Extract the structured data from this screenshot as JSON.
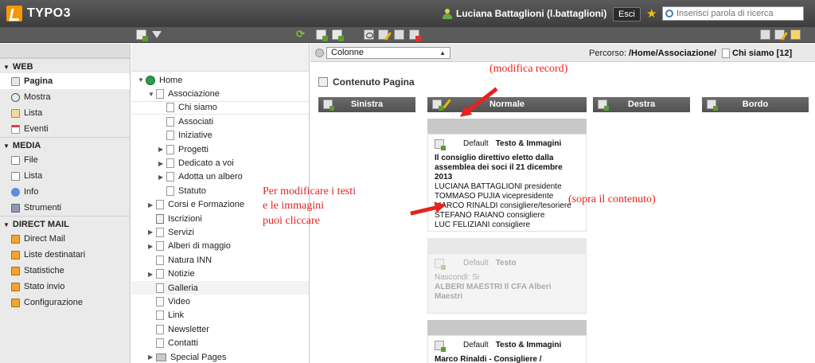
{
  "topbar": {
    "logo": "TYPO3",
    "user": "Luciana Battaglioni (l.battaglioni)",
    "logout_label": "Esci",
    "search_placeholder": "Inserisci parola di ricerca"
  },
  "sidebar": {
    "sections": [
      {
        "title": "WEB",
        "items": [
          "Pagina",
          "Mostra",
          "Lista",
          "Eventi"
        ]
      },
      {
        "title": "MEDIA",
        "items": [
          "File",
          "Lista",
          "Info",
          "Strumenti"
        ]
      },
      {
        "title": "DIRECT MAIL",
        "items": [
          "Direct Mail",
          "Liste destinatari",
          "Statistiche",
          "Stato invio",
          "Configurazione"
        ]
      }
    ],
    "active": "Pagina"
  },
  "tree": {
    "rows": [
      {
        "label": "Home",
        "level": 0,
        "twisty": "▼",
        "icon": "globe"
      },
      {
        "label": "Associazione",
        "level": 1,
        "twisty": "▼"
      },
      {
        "label": "Chi siamo",
        "level": 2,
        "twisty": "",
        "active": true
      },
      {
        "label": "Associati",
        "level": 2,
        "twisty": ""
      },
      {
        "label": "Iniziative",
        "level": 2,
        "twisty": ""
      },
      {
        "label": "Progetti",
        "level": 2,
        "twisty": "▶"
      },
      {
        "label": "Dedicato a voi",
        "level": 2,
        "twisty": "▶"
      },
      {
        "label": "Adotta un albero",
        "level": 2,
        "twisty": "▶"
      },
      {
        "label": "Statuto",
        "level": 2,
        "twisty": ""
      },
      {
        "label": "Corsi e Formazione",
        "level": 1,
        "twisty": "▶"
      },
      {
        "label": "Iscrizioni",
        "level": 1,
        "twisty": "",
        "icon": "restricted"
      },
      {
        "label": "Servizi",
        "level": 1,
        "twisty": "▶"
      },
      {
        "label": "Alberi di maggio",
        "level": 1,
        "twisty": "▶"
      },
      {
        "label": "Natura INN",
        "level": 1,
        "twisty": ""
      },
      {
        "label": "Notizie",
        "level": 1,
        "twisty": "▶"
      },
      {
        "label": "Galleria",
        "level": 1,
        "twisty": "",
        "gal": true
      },
      {
        "label": "Video",
        "level": 1,
        "twisty": ""
      },
      {
        "label": "Link",
        "level": 1,
        "twisty": ""
      },
      {
        "label": "Newsletter",
        "level": 1,
        "twisty": ""
      },
      {
        "label": "Contatti",
        "level": 1,
        "twisty": ""
      },
      {
        "label": "Special Pages",
        "level": 1,
        "twisty": "▶",
        "icon": "folder"
      }
    ]
  },
  "content": {
    "view_select": "Colonne",
    "path_label": "Percorso:",
    "path_value": "/Home/Associazione/",
    "path_page": "Chi siamo [12]",
    "title": "Contenuto Pagina",
    "columns": [
      "Sinistra",
      "Normale",
      "Destra",
      "Bordo"
    ],
    "records": [
      {
        "lang": "Default",
        "type": "Testo & Immagini",
        "title": "Il consiglio direttivo eletto dalla assemblea dei soci il 21 dicembre 2013",
        "lines": [
          "LUCIANA BATTAGLIONI presidente",
          "TOMMASO PUJIA vicepresidente",
          "MARCO RINALDI consigliere/tesoriere",
          "STEFANO RAIANO consigliere",
          "LUC FELIZIANI consigliere"
        ]
      },
      {
        "lang": "Default",
        "type": "Testo",
        "hidden_label": "Nascondi: Si",
        "title": "ALBERI MAESTRI Il CFA Alberi Maestri"
      },
      {
        "lang": "Default",
        "type": "Testo & Immagini",
        "title": "Marco Rinaldi - Consigliere /"
      }
    ]
  },
  "annotations": {
    "edit_record": "(modifica record)",
    "click_hint_1": "Per modificare i testi",
    "click_hint_2": "e le immagini",
    "click_hint_3": "puoi cliccare",
    "over_content": "(sopra il contenuto)"
  },
  "colors": {
    "annotation_red": "#e8221e",
    "typo3_orange": "#f49700"
  }
}
